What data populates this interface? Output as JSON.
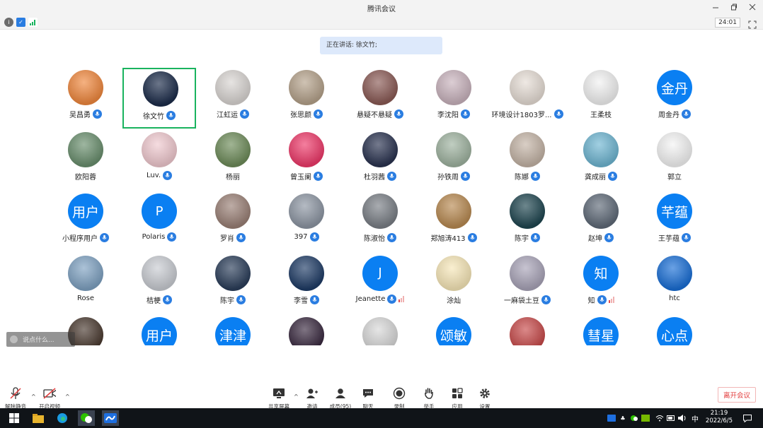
{
  "window": {
    "title": "腾讯会议"
  },
  "timer": "24:01",
  "speaking_banner": "正在讲话: 徐文竹;",
  "participants": [
    {
      "name": "吴昌勇",
      "mic": true,
      "avatar": {
        "type": "photo",
        "bg": "#f0883e"
      }
    },
    {
      "name": "徐文竹",
      "mic": true,
      "active": true,
      "avatar": {
        "type": "photo",
        "bg": "#1c2c4a"
      }
    },
    {
      "name": "江虹运",
      "mic": true,
      "avatar": {
        "type": "photo",
        "bg": "#d9d5d2"
      }
    },
    {
      "name": "张思颜",
      "mic": true,
      "avatar": {
        "type": "photo",
        "bg": "#b5a28b"
      }
    },
    {
      "name": "悬疑不悬疑",
      "mic": true,
      "avatar": {
        "type": "photo",
        "bg": "#8a5a55"
      }
    },
    {
      "name": "李沈阳",
      "mic": true,
      "avatar": {
        "type": "photo",
        "bg": "#c9b3bd"
      }
    },
    {
      "name": "环境设计1803罗...",
      "mic": true,
      "avatar": {
        "type": "photo",
        "bg": "#e6ddd5"
      }
    },
    {
      "name": "王柔枝",
      "mic": false,
      "avatar": {
        "type": "photo",
        "bg": "#f2f2f2"
      }
    },
    {
      "name": "周金丹",
      "mic": true,
      "avatar": {
        "type": "text",
        "text": "金丹"
      }
    },
    {
      "name": "欧阳蓉",
      "mic": false,
      "avatar": {
        "type": "photo",
        "bg": "#6a8f6e"
      }
    },
    {
      "name": "Luv.",
      "mic": true,
      "avatar": {
        "type": "photo",
        "bg": "#f0c9cf"
      }
    },
    {
      "name": "杨丽",
      "mic": false,
      "avatar": {
        "type": "photo",
        "bg": "#6e8c5a"
      }
    },
    {
      "name": "曾玉阑",
      "mic": true,
      "avatar": {
        "type": "photo",
        "bg": "#ee3a6a"
      }
    },
    {
      "name": "杜羽茜",
      "mic": true,
      "avatar": {
        "type": "photo",
        "bg": "#2a3350"
      }
    },
    {
      "name": "孙铁周",
      "mic": true,
      "avatar": {
        "type": "photo",
        "bg": "#9fb3a0"
      }
    },
    {
      "name": "陈娜",
      "mic": true,
      "avatar": {
        "type": "photo",
        "bg": "#c4b4a6"
      }
    },
    {
      "name": "龚成丽",
      "mic": true,
      "avatar": {
        "type": "photo",
        "bg": "#6fb6d2"
      }
    },
    {
      "name": "郭立",
      "mic": false,
      "avatar": {
        "type": "photo",
        "bg": "#f4f4f4"
      }
    },
    {
      "name": "小程序用户",
      "mic": true,
      "avatar": {
        "type": "text",
        "text": "用户"
      }
    },
    {
      "name": "Polaris",
      "mic": true,
      "avatar": {
        "type": "text",
        "text": "P",
        "letter": true
      }
    },
    {
      "name": "罗肖",
      "mic": true,
      "avatar": {
        "type": "photo",
        "bg": "#9a8076"
      }
    },
    {
      "name": "397",
      "mic": true,
      "avatar": {
        "type": "photo",
        "bg": "#8d96a3"
      }
    },
    {
      "name": "陈淑怡",
      "mic": true,
      "avatar": {
        "type": "photo",
        "bg": "#7a7f86"
      }
    },
    {
      "name": "郑旭涛413",
      "mic": true,
      "avatar": {
        "type": "photo",
        "bg": "#b88a52"
      }
    },
    {
      "name": "陈宇",
      "mic": true,
      "avatar": {
        "type": "photo",
        "bg": "#1f4650"
      }
    },
    {
      "name": "赵坤",
      "mic": true,
      "avatar": {
        "type": "photo",
        "bg": "#5f6a78"
      }
    },
    {
      "name": "王芋蕴",
      "mic": true,
      "avatar": {
        "type": "text",
        "text": "芊蕴"
      }
    },
    {
      "name": "Rose",
      "mic": false,
      "avatar": {
        "type": "photo",
        "bg": "#7fa2c2"
      }
    },
    {
      "name": "桔梗",
      "mic": true,
      "avatar": {
        "type": "photo",
        "bg": "#c9ccd2"
      }
    },
    {
      "name": "陈宇",
      "mic": true,
      "avatar": {
        "type": "photo",
        "bg": "#2b3e5a"
      }
    },
    {
      "name": "李雪",
      "mic": true,
      "avatar": {
        "type": "photo",
        "bg": "#1f3c66"
      }
    },
    {
      "name": "Jeanette",
      "mic": true,
      "signal": true,
      "avatar": {
        "type": "text",
        "text": "J",
        "letter": true
      }
    },
    {
      "name": "涂灿",
      "mic": false,
      "avatar": {
        "type": "photo",
        "bg": "#f7e7b8"
      }
    },
    {
      "name": "一麻袋土豆",
      "mic": true,
      "avatar": {
        "type": "photo",
        "bg": "#a9a4b8"
      }
    },
    {
      "name": "知",
      "mic": true,
      "signal": true,
      "avatar": {
        "type": "text",
        "text": "知"
      }
    },
    {
      "name": "htc",
      "mic": false,
      "avatar": {
        "type": "photo",
        "bg": "#1a6fd6"
      }
    },
    {
      "name": "",
      "avatar": {
        "type": "photo",
        "bg": "#4a3a30"
      }
    },
    {
      "name": "",
      "avatar": {
        "type": "text",
        "text": "用户"
      }
    },
    {
      "name": "",
      "avatar": {
        "type": "text",
        "text": "津津"
      }
    },
    {
      "name": "",
      "avatar": {
        "type": "photo",
        "bg": "#3a2a40"
      }
    },
    {
      "name": "",
      "avatar": {
        "type": "photo",
        "bg": "#d8d8d8"
      }
    },
    {
      "name": "",
      "avatar": {
        "type": "text",
        "text": "颂敏"
      }
    },
    {
      "name": "",
      "avatar": {
        "type": "photo",
        "bg": "#c74a4a"
      }
    },
    {
      "name": "",
      "avatar": {
        "type": "text",
        "text": "彗星"
      }
    },
    {
      "name": "",
      "avatar": {
        "type": "text",
        "text": "心点"
      }
    }
  ],
  "chat": {
    "placeholder": "说点什么..."
  },
  "toolbar": {
    "unmute": "解除静音",
    "video": "开启视频",
    "share": "共享屏幕",
    "invite": "邀请",
    "members": "成员(95)",
    "chat": "聊天",
    "record": "录制",
    "raise_hand": "举手",
    "apps": "应用",
    "settings": "设置",
    "leave": "离开会议"
  },
  "taskbar": {
    "time": "21:19",
    "date": "2022/6/5",
    "ime": "中"
  },
  "colors": {
    "accent": "#0a7ff2",
    "active_border": "#19b35e",
    "leave": "#e23c3c",
    "banner": "#dde9fb"
  }
}
